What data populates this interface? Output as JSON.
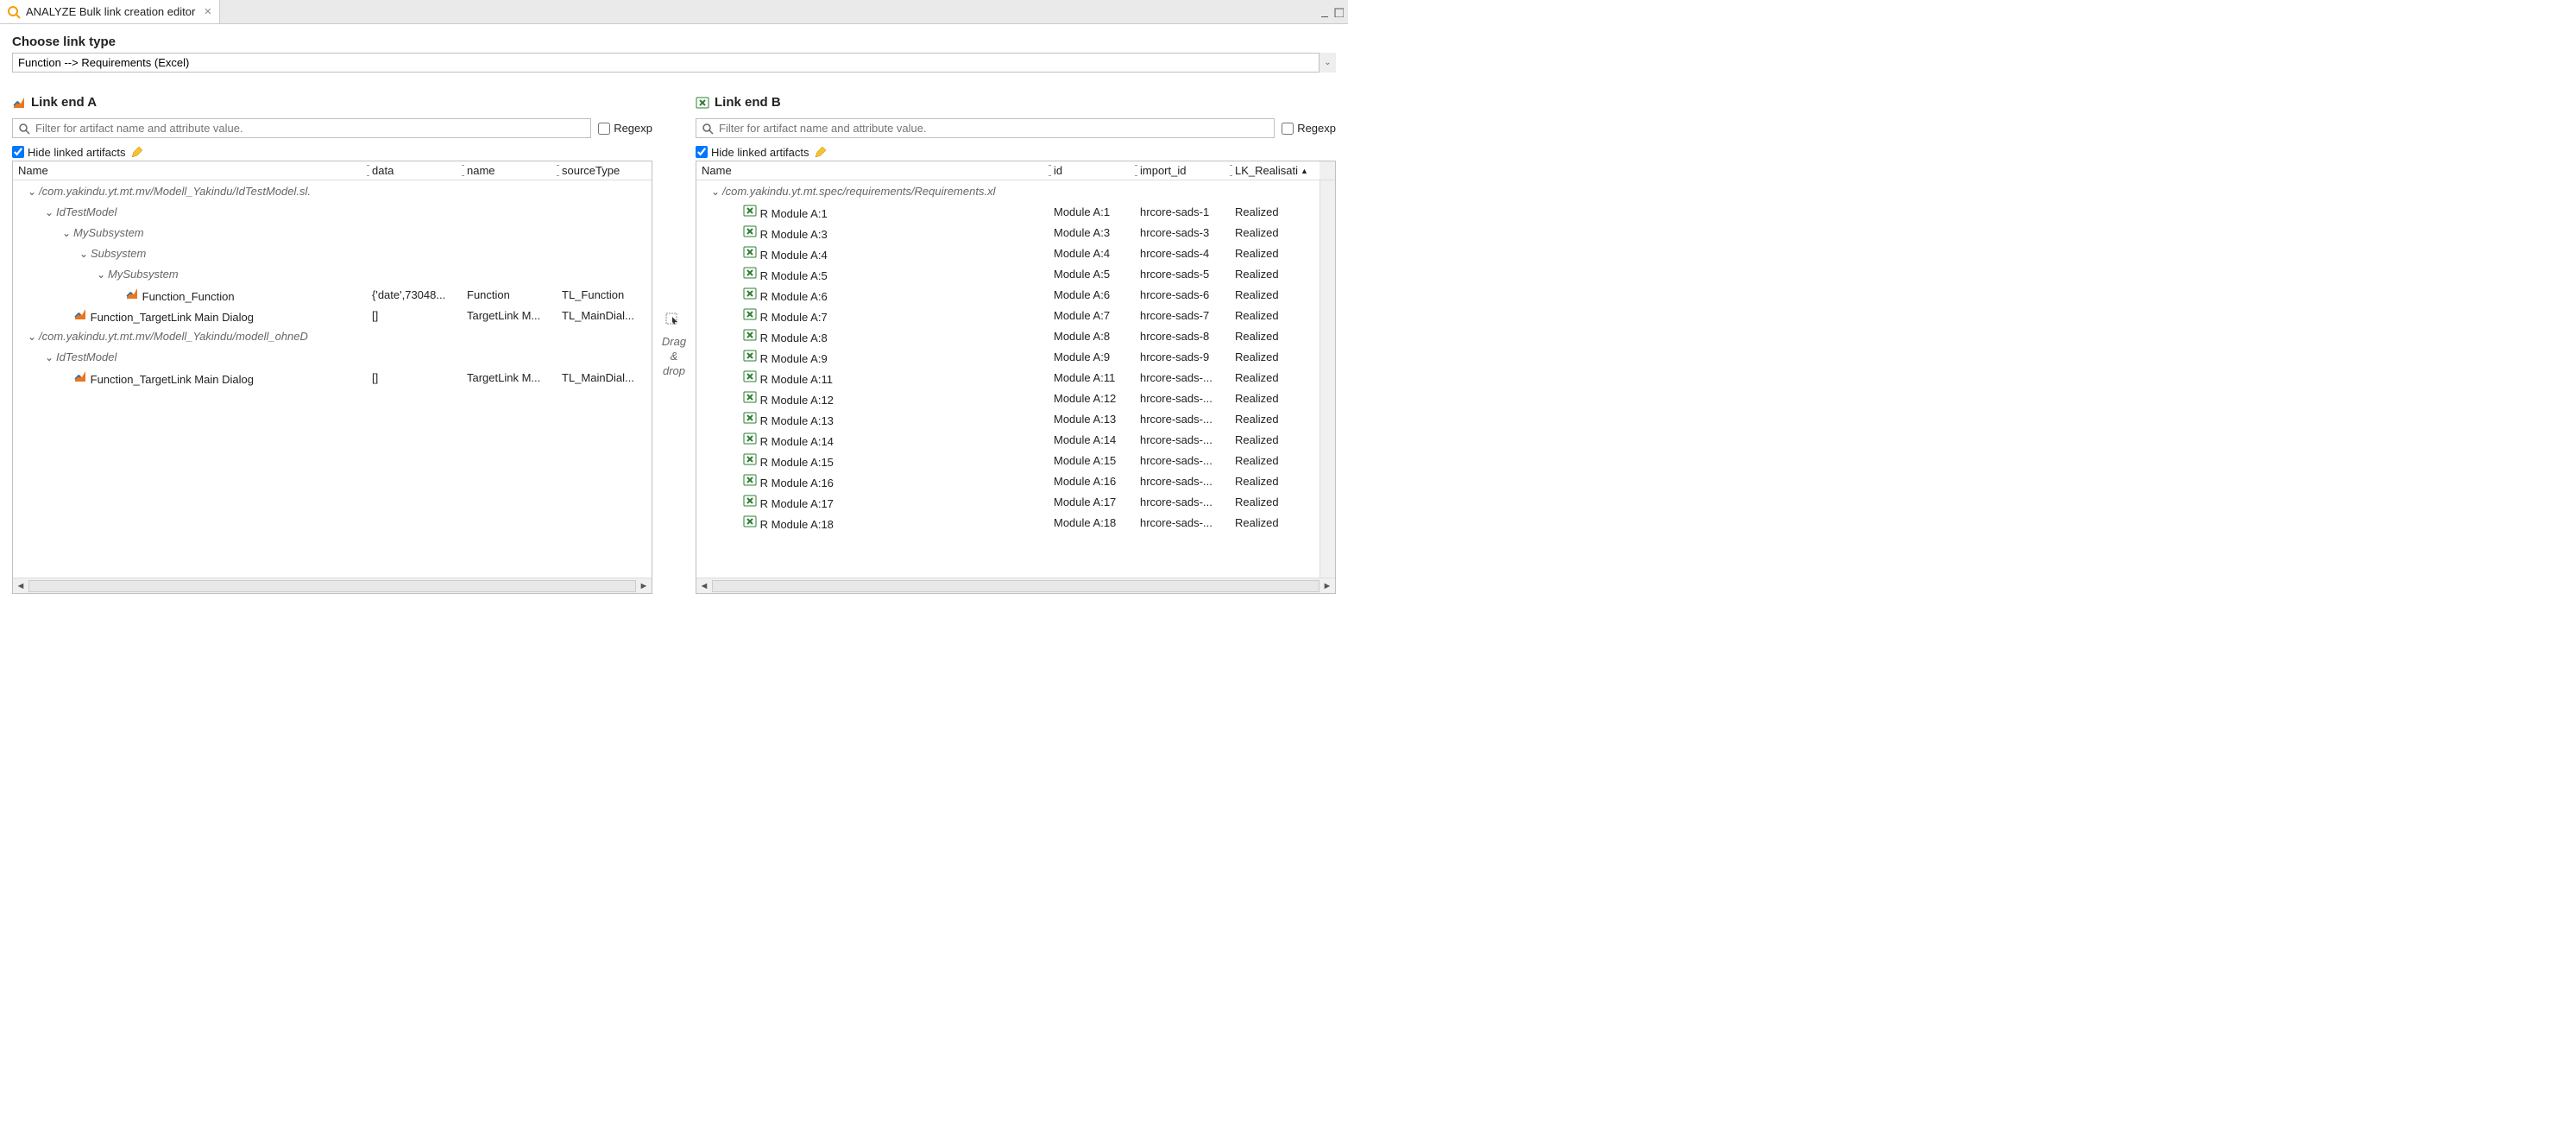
{
  "tab": {
    "title": "ANALYZE Bulk link creation editor"
  },
  "header": {
    "choose_label": "Choose link type",
    "link_type_value": "Function --> Requirements (Excel)"
  },
  "paneA": {
    "title": "Link end A",
    "filter_placeholder": "Filter for artifact name and attribute value.",
    "regexp_label": "Regexp",
    "hide_label": "Hide linked artifacts",
    "hide_checked": true,
    "columns": {
      "c1": "Name",
      "c2": "data",
      "c3": "name",
      "c4": "sourceType"
    },
    "tree": [
      {
        "depth": 0,
        "exp": "open",
        "italic": true,
        "label": "/com.yakindu.yt.mt.mv/Modell_Yakindu/IdTestModel.sl.",
        "icon": null
      },
      {
        "depth": 1,
        "exp": "open",
        "italic": true,
        "label": "IdTestModel",
        "icon": null
      },
      {
        "depth": 2,
        "exp": "open",
        "italic": true,
        "label": "MySubsystem",
        "icon": null
      },
      {
        "depth": 3,
        "exp": "open",
        "italic": true,
        "label": "Subsystem",
        "icon": null
      },
      {
        "depth": 4,
        "exp": "open",
        "italic": true,
        "label": "MySubsystem",
        "icon": null
      },
      {
        "depth": 5,
        "exp": null,
        "italic": false,
        "label": "Function_Function",
        "icon": "matlab",
        "data": "{'date',73048...",
        "name": "Function",
        "sourceType": "TL_Function"
      },
      {
        "depth": 2,
        "exp": null,
        "italic": false,
        "label": "Function_TargetLink Main Dialog",
        "icon": "matlab",
        "data": "[]",
        "name": "TargetLink M...",
        "sourceType": "TL_MainDial..."
      },
      {
        "depth": 0,
        "exp": "open",
        "italic": true,
        "label": "/com.yakindu.yt.mt.mv/Modell_Yakindu/modell_ohneD",
        "icon": null
      },
      {
        "depth": 1,
        "exp": "open",
        "italic": true,
        "label": "IdTestModel",
        "icon": null
      },
      {
        "depth": 2,
        "exp": null,
        "italic": false,
        "label": "Function_TargetLink Main Dialog",
        "icon": "matlab",
        "data": "[]",
        "name": "TargetLink M...",
        "sourceType": "TL_MainDial..."
      }
    ]
  },
  "drag": {
    "l1": "Drag",
    "l2": "&",
    "l3": "drop"
  },
  "paneB": {
    "title": "Link end B",
    "filter_placeholder": "Filter for artifact name and attribute value.",
    "regexp_label": "Regexp",
    "hide_label": "Hide linked artifacts",
    "hide_checked": true,
    "columns": {
      "c1": "Name",
      "c2": "id",
      "c3": "import_id",
      "c4": "LK_Realisati"
    },
    "root": {
      "depth": 0,
      "exp": "open",
      "italic": true,
      "label": "/com.yakindu.yt.mt.spec/requirements/Requirements.xl"
    },
    "rows": [
      {
        "label": "R Module A:1",
        "id": "Module A:1",
        "import_id": "hrcore-sads-1",
        "lk": "Realized"
      },
      {
        "label": "R Module A:3",
        "id": "Module A:3",
        "import_id": "hrcore-sads-3",
        "lk": "Realized"
      },
      {
        "label": "R Module A:4",
        "id": "Module A:4",
        "import_id": "hrcore-sads-4",
        "lk": "Realized"
      },
      {
        "label": "R Module A:5",
        "id": "Module A:5",
        "import_id": "hrcore-sads-5",
        "lk": "Realized"
      },
      {
        "label": "R Module A:6",
        "id": "Module A:6",
        "import_id": "hrcore-sads-6",
        "lk": "Realized"
      },
      {
        "label": "R Module A:7",
        "id": "Module A:7",
        "import_id": "hrcore-sads-7",
        "lk": "Realized"
      },
      {
        "label": "R Module A:8",
        "id": "Module A:8",
        "import_id": "hrcore-sads-8",
        "lk": "Realized"
      },
      {
        "label": "R Module A:9",
        "id": "Module A:9",
        "import_id": "hrcore-sads-9",
        "lk": "Realized"
      },
      {
        "label": "R Module A:11",
        "id": "Module A:11",
        "import_id": "hrcore-sads-...",
        "lk": "Realized"
      },
      {
        "label": "R Module A:12",
        "id": "Module A:12",
        "import_id": "hrcore-sads-...",
        "lk": "Realized"
      },
      {
        "label": "R Module A:13",
        "id": "Module A:13",
        "import_id": "hrcore-sads-...",
        "lk": "Realized"
      },
      {
        "label": "R Module A:14",
        "id": "Module A:14",
        "import_id": "hrcore-sads-...",
        "lk": "Realized"
      },
      {
        "label": "R Module A:15",
        "id": "Module A:15",
        "import_id": "hrcore-sads-...",
        "lk": "Realized"
      },
      {
        "label": "R Module A:16",
        "id": "Module A:16",
        "import_id": "hrcore-sads-...",
        "lk": "Realized"
      },
      {
        "label": "R Module A:17",
        "id": "Module A:17",
        "import_id": "hrcore-sads-...",
        "lk": "Realized"
      },
      {
        "label": "R Module A:18",
        "id": "Module A:18",
        "import_id": "hrcore-sads-...",
        "lk": "Realized"
      }
    ]
  }
}
